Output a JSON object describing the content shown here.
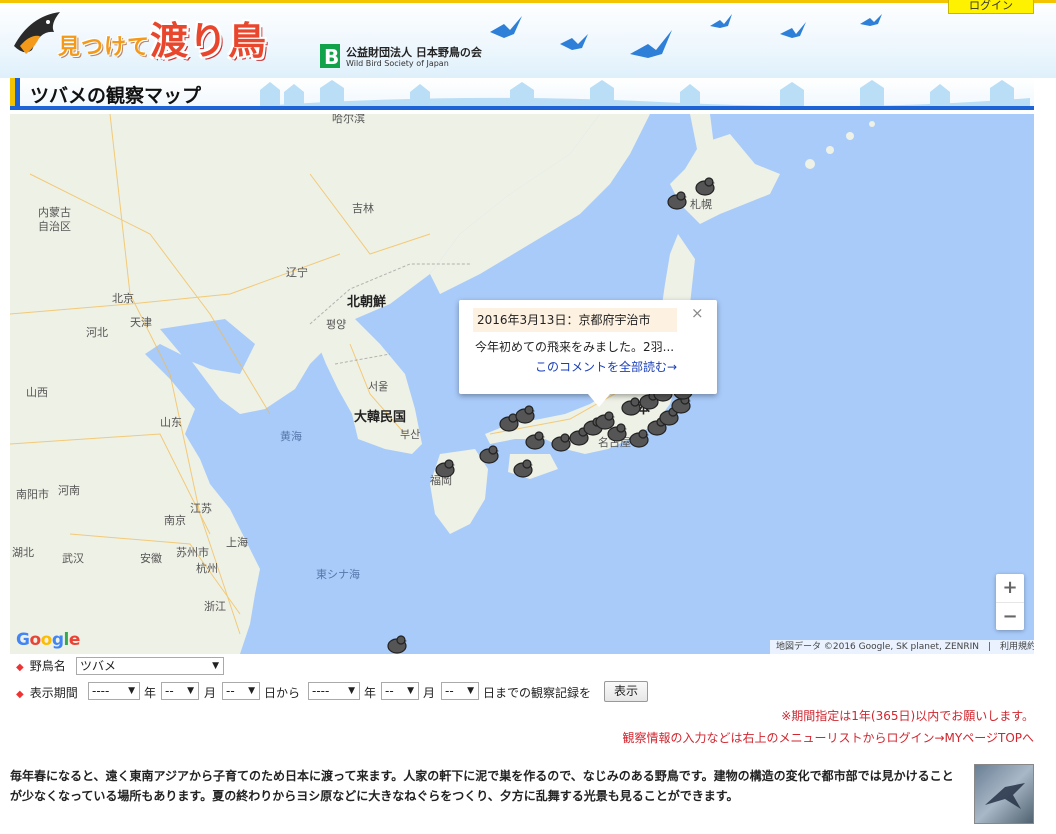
{
  "header": {
    "logo_small": "見つけて",
    "logo_big": "渡り鳥",
    "org_name": "公益財団法人 日本野鳥の会",
    "org_en": "Wild Bird Society of Japan",
    "login": "ログイン"
  },
  "page_title": "ツバメの観察マップ",
  "map": {
    "labels": {
      "harbin": "哈尔滨",
      "jilin": "吉林",
      "inner_mongolia": "内蒙古\n自治区",
      "liaoning": "辽宁",
      "beijing": "北京",
      "tianjin": "天津",
      "hebei": "河北",
      "shanxi": "山西",
      "shandong": "山东",
      "henan": "河南",
      "anhui": "安徽",
      "jiangsu": "江苏",
      "hubei": "湖北",
      "north_korea": "北朝鮮",
      "pyongyang": "평양",
      "seoul": "서울",
      "south_korea": "大韓民国",
      "busan": "부산",
      "yellow_sea": "黄海",
      "east_china_sea": "東シナ海",
      "nanyang": "南阳市",
      "nanjing": "南京",
      "suzhou": "苏州市",
      "shanghai": "上海",
      "wuhan": "武汉",
      "hangzhou": "杭州",
      "zhejiang": "浙江",
      "fukuoka": "福岡",
      "japan": "日本",
      "nagoya": "名古屋",
      "sapporo": "札幌"
    },
    "popup": {
      "date": "2016年3月13日：京都府宇治市",
      "comment": "今年初めての飛来をみました。2羽...",
      "read_all": "このコメントを全部読む→",
      "close": "×"
    },
    "zoom_in": "+",
    "zoom_out": "−",
    "google": "Google",
    "attribution": "地図データ ©2016 Google, SK planet, ZENRIN　|　利用規約"
  },
  "controls": {
    "bird_label": "野鳥名",
    "bird_value": "ツバメ",
    "period_label": "表示期間",
    "year_placeholder": "----",
    "md_placeholder": "--",
    "year_unit": "年",
    "month_unit": "月",
    "from_text": "日から",
    "until_text": "日までの観察記録を",
    "show_button": "表示",
    "notice1": "※期間指定は1年(365日)以内でお願いします。",
    "notice2": "観察情報の入力などは右上のメニューリストからログイン→MYページTOPへ"
  },
  "description": "毎年春になると、遠く東南アジアから子育てのため日本に渡って来ます。人家の軒下に泥で巣を作るので、なじみのある野鳥です。建物の構造の変化で都市部では見かけることが少なくなっている場所もあります。夏の終わりからヨシ原などに大きなねぐらをつくり、夕方に乱舞する光景も見ることができます。",
  "colors": {
    "accent_blue": "#1e63d6",
    "accent_yellow": "#f5c400",
    "sea": "#a9cbfa",
    "land": "#eef1e6",
    "notice_red": "#d0262f"
  }
}
